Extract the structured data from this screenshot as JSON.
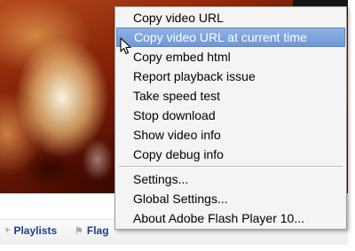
{
  "links": {
    "playlists": "Playlists",
    "flag": "Flag"
  },
  "context_menu": {
    "items": [
      {
        "label": "Copy video URL",
        "highlighted": false
      },
      {
        "label": "Copy video URL at current time",
        "highlighted": true
      },
      {
        "label": "Copy embed html",
        "highlighted": false
      },
      {
        "label": "Report playback issue",
        "highlighted": false
      },
      {
        "label": "Take speed test",
        "highlighted": false
      },
      {
        "label": "Stop download",
        "highlighted": false
      },
      {
        "label": "Show video info",
        "highlighted": false
      },
      {
        "label": "Copy debug info",
        "highlighted": false
      }
    ],
    "footer_items": [
      {
        "label": "Settings..."
      },
      {
        "label": "Global Settings..."
      },
      {
        "label": "About Adobe Flash Player 10..."
      }
    ]
  },
  "colors": {
    "highlight": "#7ea4dd",
    "link": "#1c3e8a",
    "menu_bg": "#f4f4f4"
  }
}
